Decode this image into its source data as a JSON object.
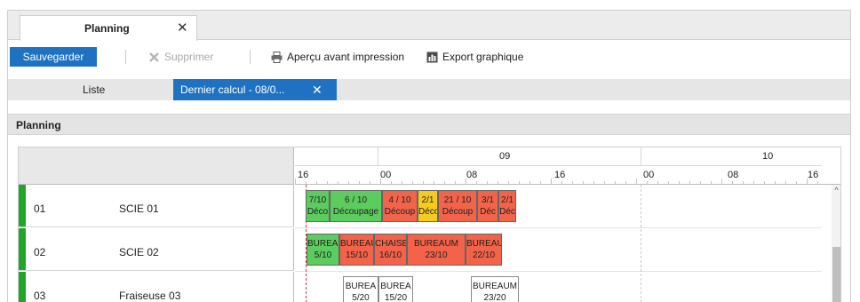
{
  "doc_tab": {
    "label": "Planning",
    "close": "✕"
  },
  "toolbar": {
    "save": "Sauvegarder",
    "delete": "Supprimer",
    "print_preview": "Aperçu avant impression",
    "export": "Export graphique"
  },
  "view_tabs": {
    "list": "Liste",
    "active": "Dernier calcul - 08/0...",
    "active_close": "✕"
  },
  "section": {
    "title": "Planning"
  },
  "timeline": {
    "days": [
      {
        "label": "09"
      },
      {
        "label": "10"
      }
    ],
    "hours": [
      "16",
      "00",
      "08",
      "16",
      "00",
      "08",
      "16"
    ]
  },
  "resources": [
    {
      "code": "01",
      "name": "SCIE 01"
    },
    {
      "code": "02",
      "name": "SCIE 02"
    },
    {
      "code": "03",
      "name": "Fraiseuse 03"
    }
  ],
  "tasks": {
    "r1": [
      {
        "l1": "7/10",
        "l2": "Déco",
        "color": "green"
      },
      {
        "l1": "6 / 10",
        "l2": "Découpage",
        "color": "green"
      },
      {
        "l1": "4 / 10",
        "l2": "Découp",
        "color": "red"
      },
      {
        "l1": "2/1",
        "l2": "Déco",
        "color": "yellow"
      },
      {
        "l1": "21 / 10",
        "l2": "Découp",
        "color": "red"
      },
      {
        "l1": "3/1",
        "l2": "Déc",
        "color": "red"
      },
      {
        "l1": "2/1",
        "l2": "Déc",
        "color": "red"
      }
    ],
    "r2": [
      {
        "l1": "BUREAU",
        "l2": "5/10",
        "color": "green"
      },
      {
        "l1": "BUREAU",
        "l2": "15/10",
        "color": "red"
      },
      {
        "l1": "CHAISE",
        "l2": "16/10",
        "color": "red"
      },
      {
        "l1": "BUREAUM",
        "l2": "23/10",
        "color": "red"
      },
      {
        "l1": "BUREAU",
        "l2": "22/10",
        "color": "red"
      }
    ],
    "r3": [
      {
        "l1": "BUREA",
        "l2": "5/20",
        "color": "white"
      },
      {
        "l1": "BUREA",
        "l2": "15/20",
        "color": "white"
      },
      {
        "l1": "BUREAUM",
        "l2": "23/20",
        "color": "white"
      }
    ]
  },
  "colors": {
    "accent": "#1f72c2",
    "task_red": "#f2634a",
    "task_green": "#5ccc5e",
    "task_yellow": "#f5cc1e",
    "row_marker": "#22a52b",
    "now_line": "#e43535"
  }
}
